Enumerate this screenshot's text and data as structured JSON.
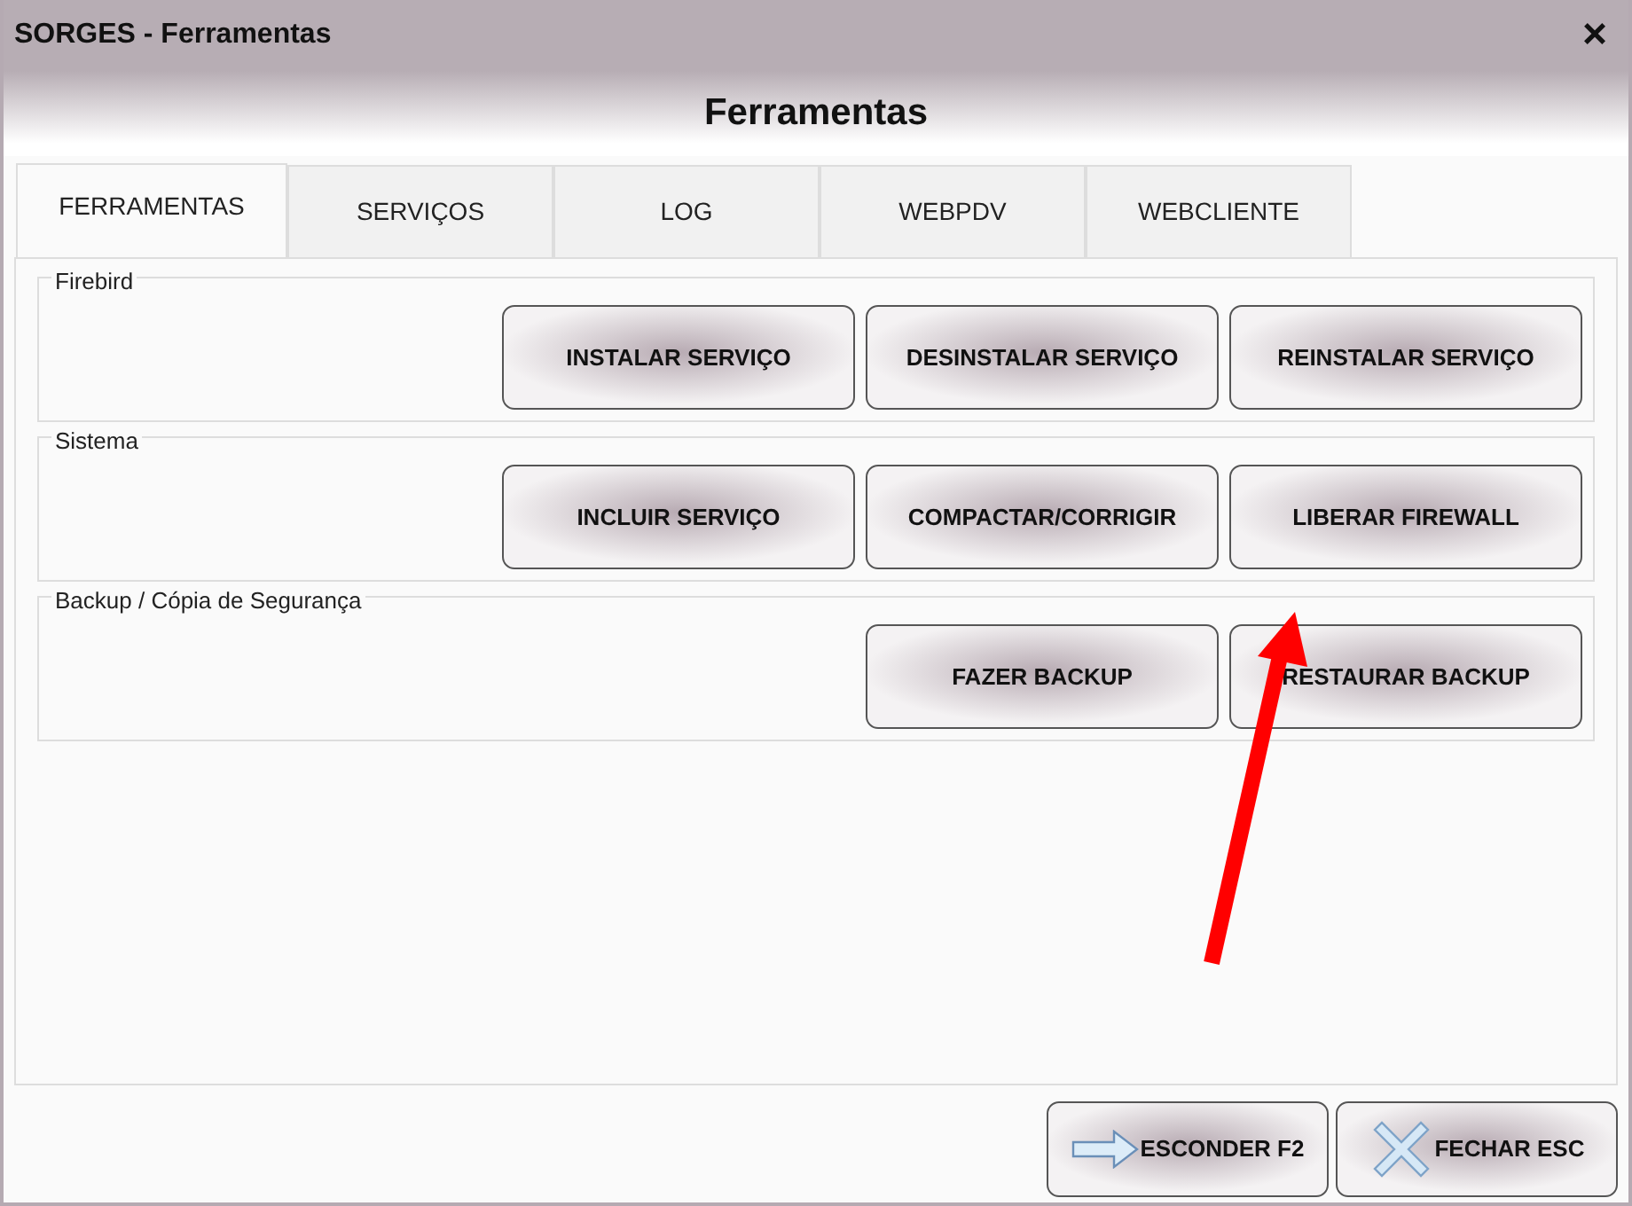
{
  "window": {
    "title": "SORGES - Ferramentas",
    "close": "×"
  },
  "header": "Ferramentas",
  "tabs": [
    {
      "label": "FERRAMENTAS",
      "selected": true
    },
    {
      "label": "SERVIÇOS",
      "selected": false
    },
    {
      "label": "LOG",
      "selected": false
    },
    {
      "label": "WEBPDV",
      "selected": false
    },
    {
      "label": "WEBCLIENTE",
      "selected": false
    }
  ],
  "groups": [
    {
      "title": "Firebird",
      "buttons": [
        "INSTALAR SERVIÇO",
        "DESINSTALAR SERVIÇO",
        "REINSTALAR SERVIÇO"
      ]
    },
    {
      "title": "Sistema",
      "buttons": [
        "INCLUIR SERVIÇO",
        "COMPACTAR/CORRIGIR",
        "LIBERAR FIREWALL"
      ]
    },
    {
      "title": "Backup / Cópia de Segurança",
      "buttons": [
        "FAZER BACKUP",
        "RESTAURAR BACKUP"
      ]
    }
  ],
  "footer_buttons": [
    {
      "kind": "hide",
      "label": "ESCONDER F2"
    },
    {
      "kind": "close",
      "label": "FECHAR ESC"
    }
  ]
}
